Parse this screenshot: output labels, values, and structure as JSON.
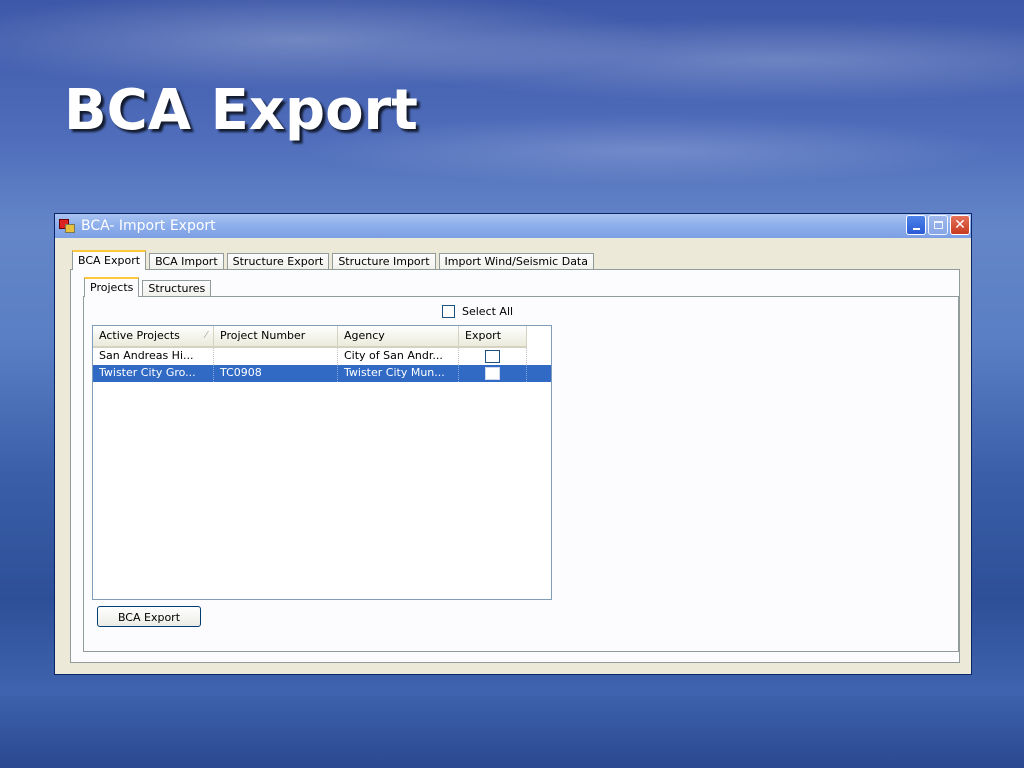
{
  "slide": {
    "title": "BCA Export"
  },
  "window": {
    "title": "BCA- Import Export",
    "controls": {
      "close_glyph": "✕"
    }
  },
  "main_tabs": [
    {
      "label": "BCA Export",
      "active": true
    },
    {
      "label": "BCA Import",
      "active": false
    },
    {
      "label": "Structure Export",
      "active": false
    },
    {
      "label": "Structure Import",
      "active": false
    },
    {
      "label": "Import Wind/Seismic Data",
      "active": false
    }
  ],
  "sub_tabs": [
    {
      "label": "Projects",
      "active": true
    },
    {
      "label": "Structures",
      "active": false
    }
  ],
  "select_all": {
    "label": "Select All",
    "checked": false
  },
  "grid": {
    "columns": [
      "Active Projects",
      "Project Number",
      "Agency",
      "Export"
    ],
    "sort_glyph": "⁄",
    "rows": [
      {
        "active_project": "San Andreas Hi...",
        "project_number": "",
        "agency": "City of San Andr...",
        "export": false,
        "selected": false
      },
      {
        "active_project": "Twister City Gro...",
        "project_number": "TC0908",
        "agency": "Twister City Mun...",
        "export": false,
        "selected": true
      }
    ]
  },
  "buttons": {
    "export_label": "BCA Export"
  },
  "icons": {
    "app": "app-window-icon",
    "minimize": "minimize-icon",
    "maximize": "maximize-icon",
    "close": "close-icon"
  }
}
